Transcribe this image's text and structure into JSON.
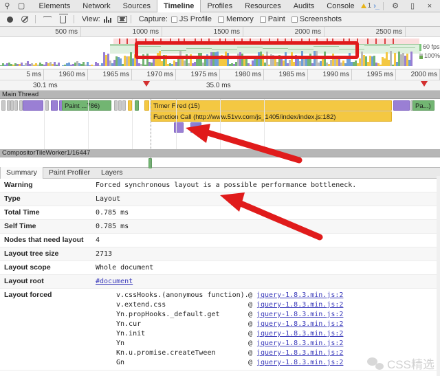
{
  "window": {
    "tabs": [
      {
        "label": "Elements",
        "active": false
      },
      {
        "label": "Network",
        "active": false
      },
      {
        "label": "Sources",
        "active": false
      },
      {
        "label": "Timeline",
        "active": true
      },
      {
        "label": "Profiles",
        "active": false
      },
      {
        "label": "Resources",
        "active": false
      },
      {
        "label": "Audits",
        "active": false
      },
      {
        "label": "Console",
        "active": false
      }
    ],
    "left_icons": [
      "inspect-icon",
      "device-toggle-icon"
    ],
    "warning_count": "1",
    "console_icon": "›_",
    "gear_icon": "gear-icon",
    "dock_icon": "dock-icon",
    "close_icon": "×"
  },
  "toolbar": {
    "record_icon": "record-icon",
    "clear_icon": "clear-icon",
    "filter_icon": "filter-icon",
    "trash_icon": "trash-icon",
    "view_label": "View:",
    "view_bars_icon": "bar-chart-view-icon",
    "view_flame_icon": "flame-chart-view-icon",
    "capture_label": "Capture:",
    "capture_options": [
      {
        "label": "JS Profile",
        "checked": false
      },
      {
        "label": "Memory",
        "checked": false
      },
      {
        "label": "Paint",
        "checked": false
      },
      {
        "label": "Screenshots",
        "checked": false
      }
    ]
  },
  "overview": {
    "ticks": [
      "500 ms",
      "1000 ms",
      "1500 ms",
      "2000 ms",
      "2500 ms"
    ],
    "fps_label": "60 fps",
    "cpu_label": "100%",
    "annotation": "red-highlight-rectangle"
  },
  "zoom_ruler": {
    "ticks": [
      "5 ms",
      "1960 ms",
      "1965 ms",
      "1970 ms",
      "1975 ms",
      "1980 ms",
      "1985 ms",
      "1990 ms",
      "1995 ms",
      "2000 ms"
    ],
    "markers": [
      {
        "label": "30.1 ms",
        "pos": 0.23
      },
      {
        "label": "35.0 ms",
        "pos": 0.62
      }
    ]
  },
  "tracks": {
    "main_thread": {
      "title": "Main Thread",
      "events": [
        {
          "label": "Paint ...786)",
          "type": "paint"
        },
        {
          "label": "Timer Fired (15)",
          "type": "script"
        },
        {
          "label": "Function Call (http://www.51vv.com/js_1405/index/index.js:182)",
          "type": "script"
        },
        {
          "label": "Pa...)",
          "type": "paint"
        }
      ]
    },
    "compositor": {
      "title": "CompositorTileWorker1/16447"
    }
  },
  "detail": {
    "tabs": [
      {
        "label": "Summary",
        "active": true
      },
      {
        "label": "Paint Profiler",
        "active": false
      },
      {
        "label": "Layers",
        "active": false
      }
    ],
    "rows": [
      {
        "key": "Warning",
        "value": "Forced synchronous layout is a possible performance bottleneck."
      },
      {
        "key": "Type",
        "value": "Layout"
      },
      {
        "key": "Total Time",
        "value": "0.785 ms"
      },
      {
        "key": "Self Time",
        "value": "0.785 ms"
      },
      {
        "key": "Nodes that need layout",
        "value": "4"
      },
      {
        "key": "Layout tree size",
        "value": "2713"
      },
      {
        "key": "Layout scope",
        "value": "Whole document"
      },
      {
        "key": "Layout root",
        "value": "#document",
        "link": true
      }
    ],
    "stack_key": "Layout forced",
    "stack": [
      {
        "fn": "v.cssHooks.(anonymous function).get",
        "at": "@",
        "url": "jquery-1.8.3.min.js:2"
      },
      {
        "fn": "v.extend.css",
        "at": "@",
        "url": "jquery-1.8.3.min.js:2"
      },
      {
        "fn": "Yn.propHooks._default.get",
        "at": "@",
        "url": "jquery-1.8.3.min.js:2"
      },
      {
        "fn": "Yn.cur",
        "at": "@",
        "url": "jquery-1.8.3.min.js:2"
      },
      {
        "fn": "Yn.init",
        "at": "@",
        "url": "jquery-1.8.3.min.js:2"
      },
      {
        "fn": "Yn",
        "at": "@",
        "url": "jquery-1.8.3.min.js:2"
      },
      {
        "fn": "Kn.u.promise.createTween",
        "at": "@",
        "url": "jquery-1.8.3.min.js:2"
      },
      {
        "fn": "Gn",
        "at": "@",
        "url": "jquery-1.8.3.min.js:2"
      }
    ]
  },
  "watermark": {
    "text": "CSS精选",
    "icon": "wechat-icon"
  },
  "colors": {
    "accent_red": "#e01b1b",
    "script_yellow": "#f4c842",
    "paint_green": "#72b572",
    "layout_purple": "#9a7fd4",
    "link_blue": "#5a4bd0"
  }
}
